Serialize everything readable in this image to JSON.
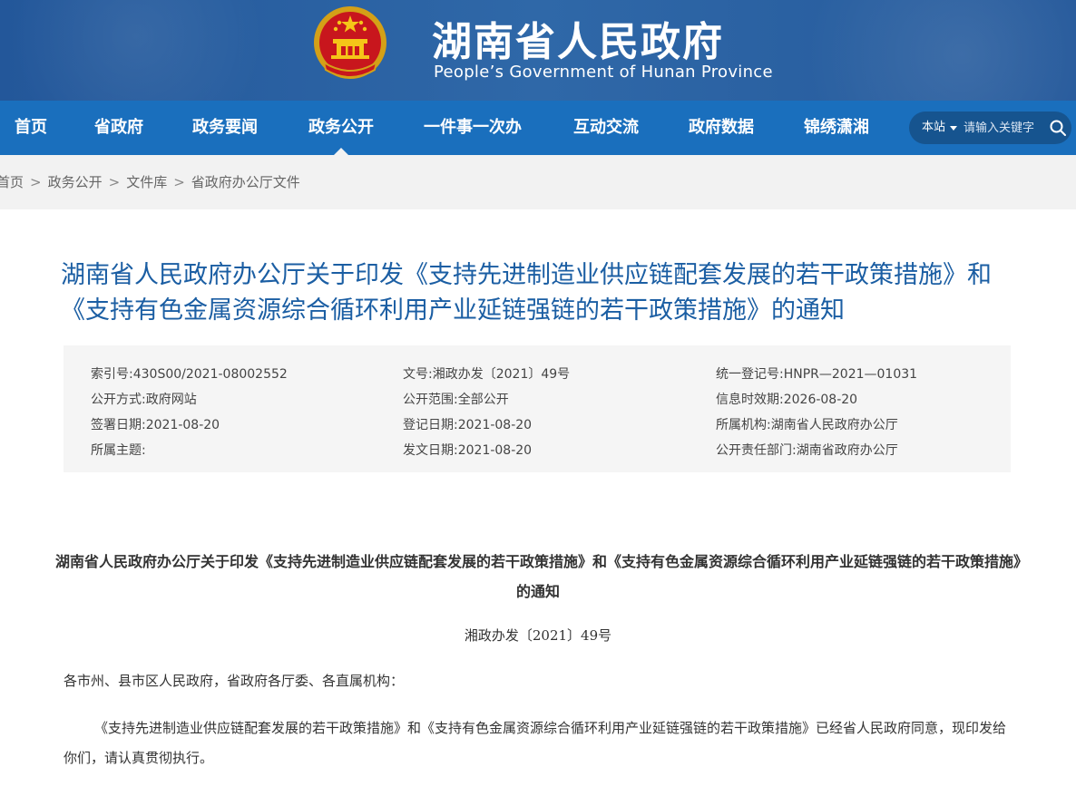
{
  "header": {
    "title": "湖南省人民政府",
    "subtitle": "People’s Government of Hunan Province",
    "emblem_icon": "national-emblem"
  },
  "nav": {
    "items": [
      {
        "label": "首页"
      },
      {
        "label": "省政府"
      },
      {
        "label": "政务要闻"
      },
      {
        "label": "政务公开",
        "active": true
      },
      {
        "label": "一件事一次办"
      },
      {
        "label": "互动交流"
      },
      {
        "label": "政府数据"
      },
      {
        "label": "锦绣潇湘"
      }
    ],
    "search": {
      "scope": "本站",
      "placeholder": "请输入关键字",
      "icon": "search-icon"
    }
  },
  "breadcrumb": {
    "items": [
      "首页",
      "政务公开",
      "文件库",
      "省政府办公厅文件"
    ],
    "separator": ">"
  },
  "article": {
    "title": "湖南省人民政府办公厅关于印发《支持先进制造业供应链配套发展的若干政策措施》和《支持有色金属资源综合循环利用产业延链强链的若干政策措施》的通知",
    "meta": [
      {
        "label": "索引号:",
        "value": "430S00/2021-08002552"
      },
      {
        "label": "文号:",
        "value": "湘政办发〔2021〕49号"
      },
      {
        "label": "统一登记号:",
        "value": "HNPR—2021—01031"
      },
      {
        "label": "公开方式:",
        "value": "政府网站"
      },
      {
        "label": "公开范围:",
        "value": "全部公开"
      },
      {
        "label": "信息时效期:",
        "value": "2026-08-20"
      },
      {
        "label": "签署日期:",
        "value": "2021-08-20"
      },
      {
        "label": "登记日期:",
        "value": "2021-08-20"
      },
      {
        "label": "所属机构:",
        "value": "湖南省人民政府办公厅"
      },
      {
        "label": "所属主题:",
        "value": ""
      },
      {
        "label": "发文日期:",
        "value": "2021-08-20"
      },
      {
        "label": "公开责任部门:",
        "value": "湖南省政府办公厅"
      }
    ],
    "doc_title": "湖南省人民政府办公厅关于印发《支持先进制造业供应链配套发展的若干政策措施》和《支持有色金属资源综合循环利用产业延链强链的若干政策措施》的通知",
    "doc_number": "湘政办发〔2021〕49号",
    "salutation": "各市州、县市区人民政府，省政府各厅委、各直属机构：",
    "paragraph": "《支持先进制造业供应链配套发展的若干政策措施》和《支持有色金属资源综合循环利用产业延链强链的若干政策措施》已经省人民政府同意，现印发给你们，请认真贯彻执行。"
  },
  "colors": {
    "header_bg": "#2b62a0",
    "nav_bg": "#1a6fbd",
    "title_blue": "#1b5ea3",
    "meta_bg": "#f5f5f5"
  }
}
